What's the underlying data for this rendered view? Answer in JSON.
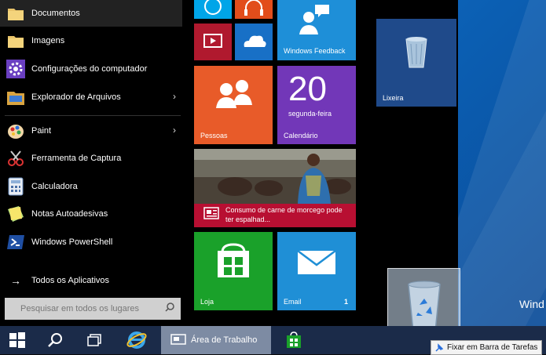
{
  "desktop": {
    "watermark": "Wind"
  },
  "start_menu": {
    "places": [
      {
        "label": "Documentos"
      },
      {
        "label": "Imagens"
      },
      {
        "label": "Configurações do computador"
      },
      {
        "label": "Explorador de Arquivos"
      }
    ],
    "apps": [
      {
        "label": "Paint"
      },
      {
        "label": "Ferramenta de Captura"
      },
      {
        "label": "Calculadora"
      },
      {
        "label": "Notas Autoadesivas"
      },
      {
        "label": "Windows PowerShell"
      }
    ],
    "all_apps": {
      "arrow": "→",
      "label": "Todos os Aplicativos"
    },
    "search": {
      "placeholder": "Pesquisar em todos os lugares"
    }
  },
  "tiles": {
    "feedback": {
      "label": "Windows Feedback"
    },
    "people": {
      "label": "Pessoas"
    },
    "calendar": {
      "day": "20",
      "weekday": "segunda-feira",
      "label": "Calendário"
    },
    "news": {
      "headline": "Consumo de carne de morcego pode ter espalhad..."
    },
    "store": {
      "label": "Loja"
    },
    "mail": {
      "label": "Email",
      "badge": "1"
    },
    "recycle": {
      "label": "Lixeira"
    }
  },
  "taskbar": {
    "desktop_label": "Área de Trabalho"
  },
  "tooltip": {
    "text": "Fixar em Barra de Tarefas"
  },
  "colors": {
    "taskbar": "#1b2b49",
    "start_bg": "#000000",
    "people": "#e85b29",
    "calendar": "#7237b8",
    "news": "#b80f32",
    "store": "#1aa12a",
    "mail": "#1f8fd6"
  }
}
